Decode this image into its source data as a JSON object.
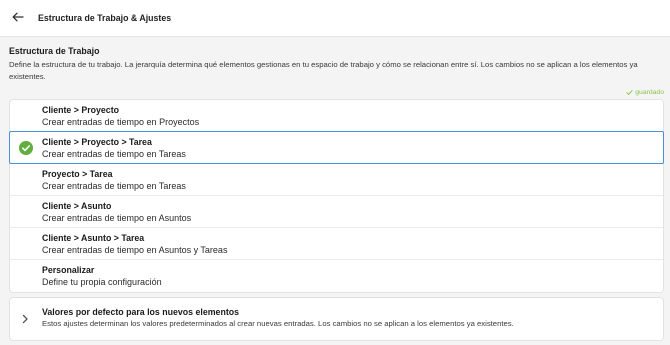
{
  "header": {
    "back_icon": "arrow-left-icon",
    "title": "Estructura de Trabajo & Ajustes"
  },
  "structure": {
    "title": "Estructura de Trabajo",
    "description": "Define la estructura de tu trabajo. La jerarquía determina qué elementos gestionas en tu espacio de trabajo y cómo se relacionan entre sí. Los cambios no se aplican a los elementos ya existentes.",
    "saved_icon": "check-icon",
    "saved_label": "guardado",
    "selected_icon": "check-circle-icon",
    "options": [
      {
        "title": "Cliente > Proyecto",
        "subtitle": "Crear entradas de tiempo en Proyectos",
        "selected": false
      },
      {
        "title": "Cliente > Proyecto > Tarea",
        "subtitle": "Crear entradas de tiempo en Tareas",
        "selected": true
      },
      {
        "title": "Proyecto > Tarea",
        "subtitle": "Crear entradas de tiempo en Tareas",
        "selected": false
      },
      {
        "title": "Cliente > Asunto",
        "subtitle": "Crear entradas de tiempo en Asuntos",
        "selected": false
      },
      {
        "title": "Cliente > Asunto > Tarea",
        "subtitle": "Crear entradas de tiempo en Asuntos y Tareas",
        "selected": false
      },
      {
        "title": "Personalizar",
        "subtitle": "Define tu propia configuración",
        "selected": false
      }
    ]
  },
  "defaults": {
    "expand_icon": "chevron-right-icon",
    "title": "Valores por defecto para los nuevos elementos",
    "description": "Estos ajustes determinan los valores predeterminados al crear nuevas entradas. Los cambios no se aplican a los elementos ya existentes.",
    "expanded": false
  },
  "colors": {
    "accent": "#4a8fe0",
    "success": "#5fae3e",
    "saved": "#8bc34a"
  }
}
